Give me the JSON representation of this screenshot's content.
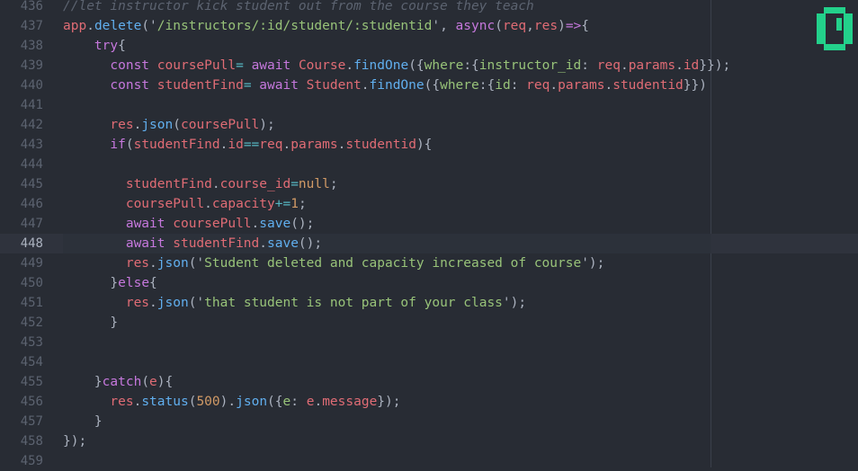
{
  "editor": {
    "lines": [
      {
        "num": "436",
        "tokens": [
          {
            "t": "//let instructor kick student out from the course they teach",
            "c": "com"
          }
        ]
      },
      {
        "num": "437",
        "tokens": [
          {
            "t": "app",
            "c": "var"
          },
          {
            "t": ".",
            "c": "pn"
          },
          {
            "t": "delete",
            "c": "fn"
          },
          {
            "t": "('",
            "c": "pn"
          },
          {
            "t": "/instructors/:id/student/:studentid",
            "c": "str"
          },
          {
            "t": "', ",
            "c": "pn"
          },
          {
            "t": "async",
            "c": "kw"
          },
          {
            "t": "(",
            "c": "pn"
          },
          {
            "t": "req",
            "c": "var"
          },
          {
            "t": ",",
            "c": "pn"
          },
          {
            "t": "res",
            "c": "var"
          },
          {
            "t": ")",
            "c": "pn"
          },
          {
            "t": "=>",
            "c": "kw"
          },
          {
            "t": "{",
            "c": "pn"
          }
        ]
      },
      {
        "num": "438",
        "tokens": [
          {
            "t": "    ",
            "c": "pn"
          },
          {
            "t": "try",
            "c": "kw"
          },
          {
            "t": "{",
            "c": "pn"
          }
        ]
      },
      {
        "num": "439",
        "tokens": [
          {
            "t": "      ",
            "c": "pn"
          },
          {
            "t": "const ",
            "c": "kw"
          },
          {
            "t": "coursePull",
            "c": "var"
          },
          {
            "t": "= ",
            "c": "op"
          },
          {
            "t": "await ",
            "c": "kw"
          },
          {
            "t": "Course",
            "c": "var"
          },
          {
            "t": ".",
            "c": "pn"
          },
          {
            "t": "findOne",
            "c": "fn"
          },
          {
            "t": "({",
            "c": "pn"
          },
          {
            "t": "where",
            "c": "str"
          },
          {
            "t": ":{",
            "c": "pn"
          },
          {
            "t": "instructor_id",
            "c": "str"
          },
          {
            "t": ": ",
            "c": "pn"
          },
          {
            "t": "req",
            "c": "var"
          },
          {
            "t": ".",
            "c": "pn"
          },
          {
            "t": "params",
            "c": "var"
          },
          {
            "t": ".",
            "c": "pn"
          },
          {
            "t": "id",
            "c": "var"
          },
          {
            "t": "}});",
            "c": "pn"
          }
        ]
      },
      {
        "num": "440",
        "tokens": [
          {
            "t": "      ",
            "c": "pn"
          },
          {
            "t": "const ",
            "c": "kw"
          },
          {
            "t": "studentFind",
            "c": "var"
          },
          {
            "t": "= ",
            "c": "op"
          },
          {
            "t": "await ",
            "c": "kw"
          },
          {
            "t": "Student",
            "c": "var"
          },
          {
            "t": ".",
            "c": "pn"
          },
          {
            "t": "findOne",
            "c": "fn"
          },
          {
            "t": "({",
            "c": "pn"
          },
          {
            "t": "where",
            "c": "str"
          },
          {
            "t": ":{",
            "c": "pn"
          },
          {
            "t": "id",
            "c": "str"
          },
          {
            "t": ": ",
            "c": "pn"
          },
          {
            "t": "req",
            "c": "var"
          },
          {
            "t": ".",
            "c": "pn"
          },
          {
            "t": "params",
            "c": "var"
          },
          {
            "t": ".",
            "c": "pn"
          },
          {
            "t": "studentid",
            "c": "var"
          },
          {
            "t": "}})",
            "c": "pn"
          }
        ]
      },
      {
        "num": "441",
        "tokens": []
      },
      {
        "num": "442",
        "tokens": [
          {
            "t": "      ",
            "c": "pn"
          },
          {
            "t": "res",
            "c": "var"
          },
          {
            "t": ".",
            "c": "pn"
          },
          {
            "t": "json",
            "c": "fn"
          },
          {
            "t": "(",
            "c": "pn"
          },
          {
            "t": "coursePull",
            "c": "var"
          },
          {
            "t": ");",
            "c": "pn"
          }
        ]
      },
      {
        "num": "443",
        "tokens": [
          {
            "t": "      ",
            "c": "pn"
          },
          {
            "t": "if",
            "c": "kw"
          },
          {
            "t": "(",
            "c": "pn"
          },
          {
            "t": "studentFind",
            "c": "var"
          },
          {
            "t": ".",
            "c": "pn"
          },
          {
            "t": "id",
            "c": "var"
          },
          {
            "t": "==",
            "c": "op"
          },
          {
            "t": "req",
            "c": "var"
          },
          {
            "t": ".",
            "c": "pn"
          },
          {
            "t": "params",
            "c": "var"
          },
          {
            "t": ".",
            "c": "pn"
          },
          {
            "t": "studentid",
            "c": "var"
          },
          {
            "t": "){",
            "c": "pn"
          }
        ]
      },
      {
        "num": "444",
        "tokens": []
      },
      {
        "num": "445",
        "tokens": [
          {
            "t": "        ",
            "c": "pn"
          },
          {
            "t": "studentFind",
            "c": "var"
          },
          {
            "t": ".",
            "c": "pn"
          },
          {
            "t": "course_id",
            "c": "var"
          },
          {
            "t": "=",
            "c": "op"
          },
          {
            "t": "null",
            "c": "num"
          },
          {
            "t": ";",
            "c": "pn"
          }
        ]
      },
      {
        "num": "446",
        "tokens": [
          {
            "t": "        ",
            "c": "pn"
          },
          {
            "t": "coursePull",
            "c": "var"
          },
          {
            "t": ".",
            "c": "pn"
          },
          {
            "t": "capacity",
            "c": "var"
          },
          {
            "t": "+=",
            "c": "op"
          },
          {
            "t": "1",
            "c": "num"
          },
          {
            "t": ";",
            "c": "pn"
          }
        ]
      },
      {
        "num": "447",
        "tokens": [
          {
            "t": "        ",
            "c": "pn"
          },
          {
            "t": "await ",
            "c": "kw"
          },
          {
            "t": "coursePull",
            "c": "var"
          },
          {
            "t": ".",
            "c": "pn"
          },
          {
            "t": "save",
            "c": "fn"
          },
          {
            "t": "();",
            "c": "pn"
          }
        ]
      },
      {
        "num": "448",
        "cursor": true,
        "tokens": [
          {
            "t": "        ",
            "c": "pn"
          },
          {
            "t": "await ",
            "c": "kw"
          },
          {
            "t": "studentFind",
            "c": "var"
          },
          {
            "t": ".",
            "c": "pn"
          },
          {
            "t": "save",
            "c": "fn"
          },
          {
            "t": "();",
            "c": "pn"
          }
        ]
      },
      {
        "num": "449",
        "tokens": [
          {
            "t": "        ",
            "c": "pn"
          },
          {
            "t": "res",
            "c": "var"
          },
          {
            "t": ".",
            "c": "pn"
          },
          {
            "t": "json",
            "c": "fn"
          },
          {
            "t": "('",
            "c": "pn"
          },
          {
            "t": "Student deleted and capacity increased of course",
            "c": "str"
          },
          {
            "t": "');",
            "c": "pn"
          }
        ]
      },
      {
        "num": "450",
        "tokens": [
          {
            "t": "      ",
            "c": "pn"
          },
          {
            "t": "}",
            "c": "pn"
          },
          {
            "t": "else",
            "c": "kw"
          },
          {
            "t": "{",
            "c": "pn"
          }
        ]
      },
      {
        "num": "451",
        "tokens": [
          {
            "t": "        ",
            "c": "pn"
          },
          {
            "t": "res",
            "c": "var"
          },
          {
            "t": ".",
            "c": "pn"
          },
          {
            "t": "json",
            "c": "fn"
          },
          {
            "t": "('",
            "c": "pn"
          },
          {
            "t": "that student is not part of your class",
            "c": "str"
          },
          {
            "t": "');",
            "c": "pn"
          }
        ]
      },
      {
        "num": "452",
        "tokens": [
          {
            "t": "      }",
            "c": "pn"
          }
        ]
      },
      {
        "num": "453",
        "tokens": []
      },
      {
        "num": "454",
        "tokens": []
      },
      {
        "num": "455",
        "tokens": [
          {
            "t": "    }",
            "c": "pn"
          },
          {
            "t": "catch",
            "c": "kw"
          },
          {
            "t": "(",
            "c": "pn"
          },
          {
            "t": "e",
            "c": "var"
          },
          {
            "t": "){",
            "c": "pn"
          }
        ]
      },
      {
        "num": "456",
        "tokens": [
          {
            "t": "      ",
            "c": "pn"
          },
          {
            "t": "res",
            "c": "var"
          },
          {
            "t": ".",
            "c": "pn"
          },
          {
            "t": "status",
            "c": "fn"
          },
          {
            "t": "(",
            "c": "pn"
          },
          {
            "t": "500",
            "c": "num"
          },
          {
            "t": ").",
            "c": "pn"
          },
          {
            "t": "json",
            "c": "fn"
          },
          {
            "t": "({",
            "c": "pn"
          },
          {
            "t": "e",
            "c": "str"
          },
          {
            "t": ": ",
            "c": "pn"
          },
          {
            "t": "e",
            "c": "var"
          },
          {
            "t": ".",
            "c": "pn"
          },
          {
            "t": "message",
            "c": "var"
          },
          {
            "t": "});",
            "c": "pn"
          }
        ]
      },
      {
        "num": "457",
        "tokens": [
          {
            "t": "    }",
            "c": "pn"
          }
        ]
      },
      {
        "num": "458",
        "tokens": [
          {
            "t": "});",
            "c": "pn"
          }
        ]
      },
      {
        "num": "459",
        "tokens": []
      }
    ]
  },
  "colors": {
    "background": "#282c34",
    "comment": "#5c6370",
    "keyword": "#c678dd",
    "variable": "#e06c75",
    "function": "#61afef",
    "string": "#98c379",
    "number": "#d19a66",
    "operator": "#56b6c2",
    "accent_icon": "#23d18b"
  },
  "minimap_icon": "code-status-icon"
}
